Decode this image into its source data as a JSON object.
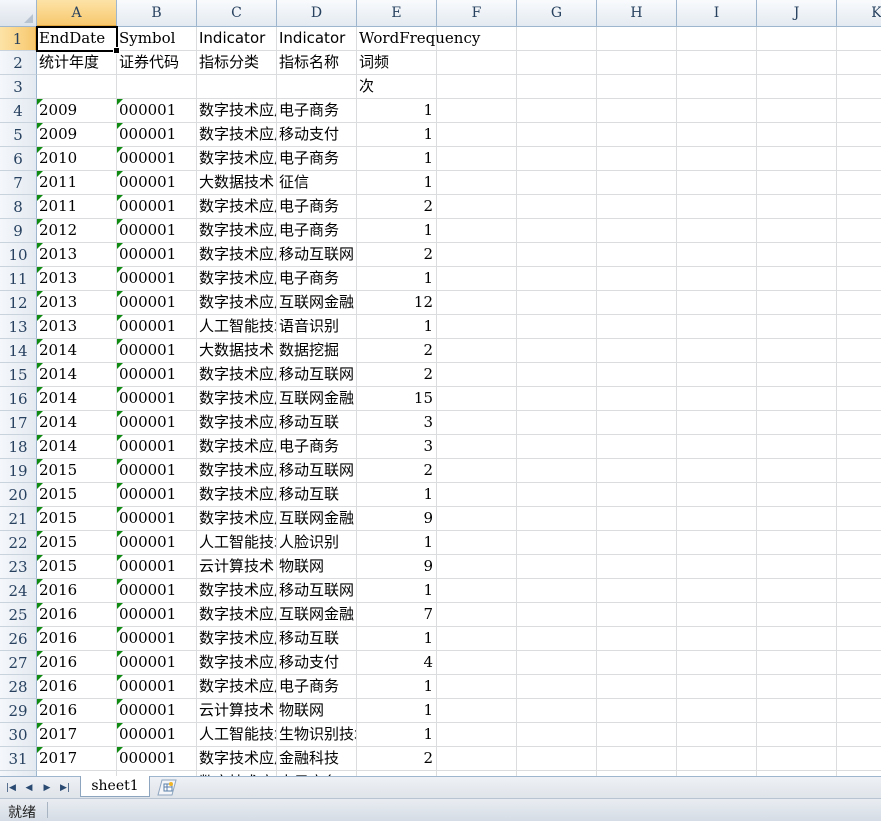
{
  "spreadsheet": {
    "columns": [
      "A",
      "B",
      "C",
      "D",
      "E",
      "F",
      "G",
      "H",
      "I",
      "J",
      "K"
    ],
    "selected_column": "A",
    "selected_row": "1",
    "rows": [
      {
        "n": "1",
        "a": "EndDate",
        "b": "Symbol",
        "c": "Indicator",
        "d": "Indicator",
        "e": "WordFrequency"
      },
      {
        "n": "2",
        "a": "统计年度",
        "b": "证券代码",
        "c": "指标分类",
        "d": "指标名称",
        "e": "词频"
      },
      {
        "n": "3",
        "a": "",
        "b": "",
        "c": "",
        "d": "",
        "e": "次"
      },
      {
        "n": "4",
        "a": "2009",
        "b": "000001",
        "c": "数字技术应用",
        "d": "电子商务",
        "e": "1"
      },
      {
        "n": "5",
        "a": "2009",
        "b": "000001",
        "c": "数字技术应用",
        "d": "移动支付",
        "e": "1"
      },
      {
        "n": "6",
        "a": "2010",
        "b": "000001",
        "c": "数字技术应用",
        "d": "电子商务",
        "e": "1"
      },
      {
        "n": "7",
        "a": "2011",
        "b": "000001",
        "c": "大数据技术",
        "d": "征信",
        "e": "1"
      },
      {
        "n": "8",
        "a": "2011",
        "b": "000001",
        "c": "数字技术应用",
        "d": "电子商务",
        "e": "2"
      },
      {
        "n": "9",
        "a": "2012",
        "b": "000001",
        "c": "数字技术应用",
        "d": "电子商务",
        "e": "1"
      },
      {
        "n": "10",
        "a": "2013",
        "b": "000001",
        "c": "数字技术应用",
        "d": "移动互联网",
        "e": "2"
      },
      {
        "n": "11",
        "a": "2013",
        "b": "000001",
        "c": "数字技术应用",
        "d": "电子商务",
        "e": "1"
      },
      {
        "n": "12",
        "a": "2013",
        "b": "000001",
        "c": "数字技术应用",
        "d": "互联网金融",
        "e": "12"
      },
      {
        "n": "13",
        "a": "2013",
        "b": "000001",
        "c": "人工智能技术",
        "d": "语音识别",
        "e": "1"
      },
      {
        "n": "14",
        "a": "2014",
        "b": "000001",
        "c": "大数据技术",
        "d": "数据挖掘",
        "e": "2"
      },
      {
        "n": "15",
        "a": "2014",
        "b": "000001",
        "c": "数字技术应用",
        "d": "移动互联网",
        "e": "2"
      },
      {
        "n": "16",
        "a": "2014",
        "b": "000001",
        "c": "数字技术应用",
        "d": "互联网金融",
        "e": "15"
      },
      {
        "n": "17",
        "a": "2014",
        "b": "000001",
        "c": "数字技术应用",
        "d": "移动互联",
        "e": "3"
      },
      {
        "n": "18",
        "a": "2014",
        "b": "000001",
        "c": "数字技术应用",
        "d": "电子商务",
        "e": "3"
      },
      {
        "n": "19",
        "a": "2015",
        "b": "000001",
        "c": "数字技术应用",
        "d": "移动互联网",
        "e": "2"
      },
      {
        "n": "20",
        "a": "2015",
        "b": "000001",
        "c": "数字技术应用",
        "d": "移动互联",
        "e": "1"
      },
      {
        "n": "21",
        "a": "2015",
        "b": "000001",
        "c": "数字技术应用",
        "d": "互联网金融",
        "e": "9"
      },
      {
        "n": "22",
        "a": "2015",
        "b": "000001",
        "c": "人工智能技术",
        "d": "人脸识别",
        "e": "1"
      },
      {
        "n": "23",
        "a": "2015",
        "b": "000001",
        "c": "云计算技术",
        "d": "物联网",
        "e": "9"
      },
      {
        "n": "24",
        "a": "2016",
        "b": "000001",
        "c": "数字技术应用",
        "d": "移动互联网",
        "e": "1"
      },
      {
        "n": "25",
        "a": "2016",
        "b": "000001",
        "c": "数字技术应用",
        "d": "互联网金融",
        "e": "7"
      },
      {
        "n": "26",
        "a": "2016",
        "b": "000001",
        "c": "数字技术应用",
        "d": "移动互联",
        "e": "1"
      },
      {
        "n": "27",
        "a": "2016",
        "b": "000001",
        "c": "数字技术应用",
        "d": "移动支付",
        "e": "4"
      },
      {
        "n": "28",
        "a": "2016",
        "b": "000001",
        "c": "数字技术应用",
        "d": "电子商务",
        "e": "1"
      },
      {
        "n": "29",
        "a": "2016",
        "b": "000001",
        "c": "云计算技术",
        "d": "物联网",
        "e": "1"
      },
      {
        "n": "30",
        "a": "2017",
        "b": "000001",
        "c": "人工智能技术",
        "d": "生物识别技术",
        "e": "1"
      },
      {
        "n": "31",
        "a": "2017",
        "b": "000001",
        "c": "数字技术应用",
        "d": "金融科技",
        "e": "2"
      },
      {
        "n": "32",
        "a": "",
        "b": "",
        "c": "数字技术应用",
        "d": "电子商务",
        "e": ""
      }
    ]
  },
  "sheet_tabs": {
    "active_tab": "sheet1",
    "nav_first": "|◀",
    "nav_prev": "◀",
    "nav_next": "▶",
    "nav_last": "▶|"
  },
  "status_bar": {
    "ready_text": "就绪"
  },
  "colors": {
    "header_accent": "#f7c86e",
    "grid_line": "#dadcdd",
    "error_triangle": "#108a10"
  }
}
